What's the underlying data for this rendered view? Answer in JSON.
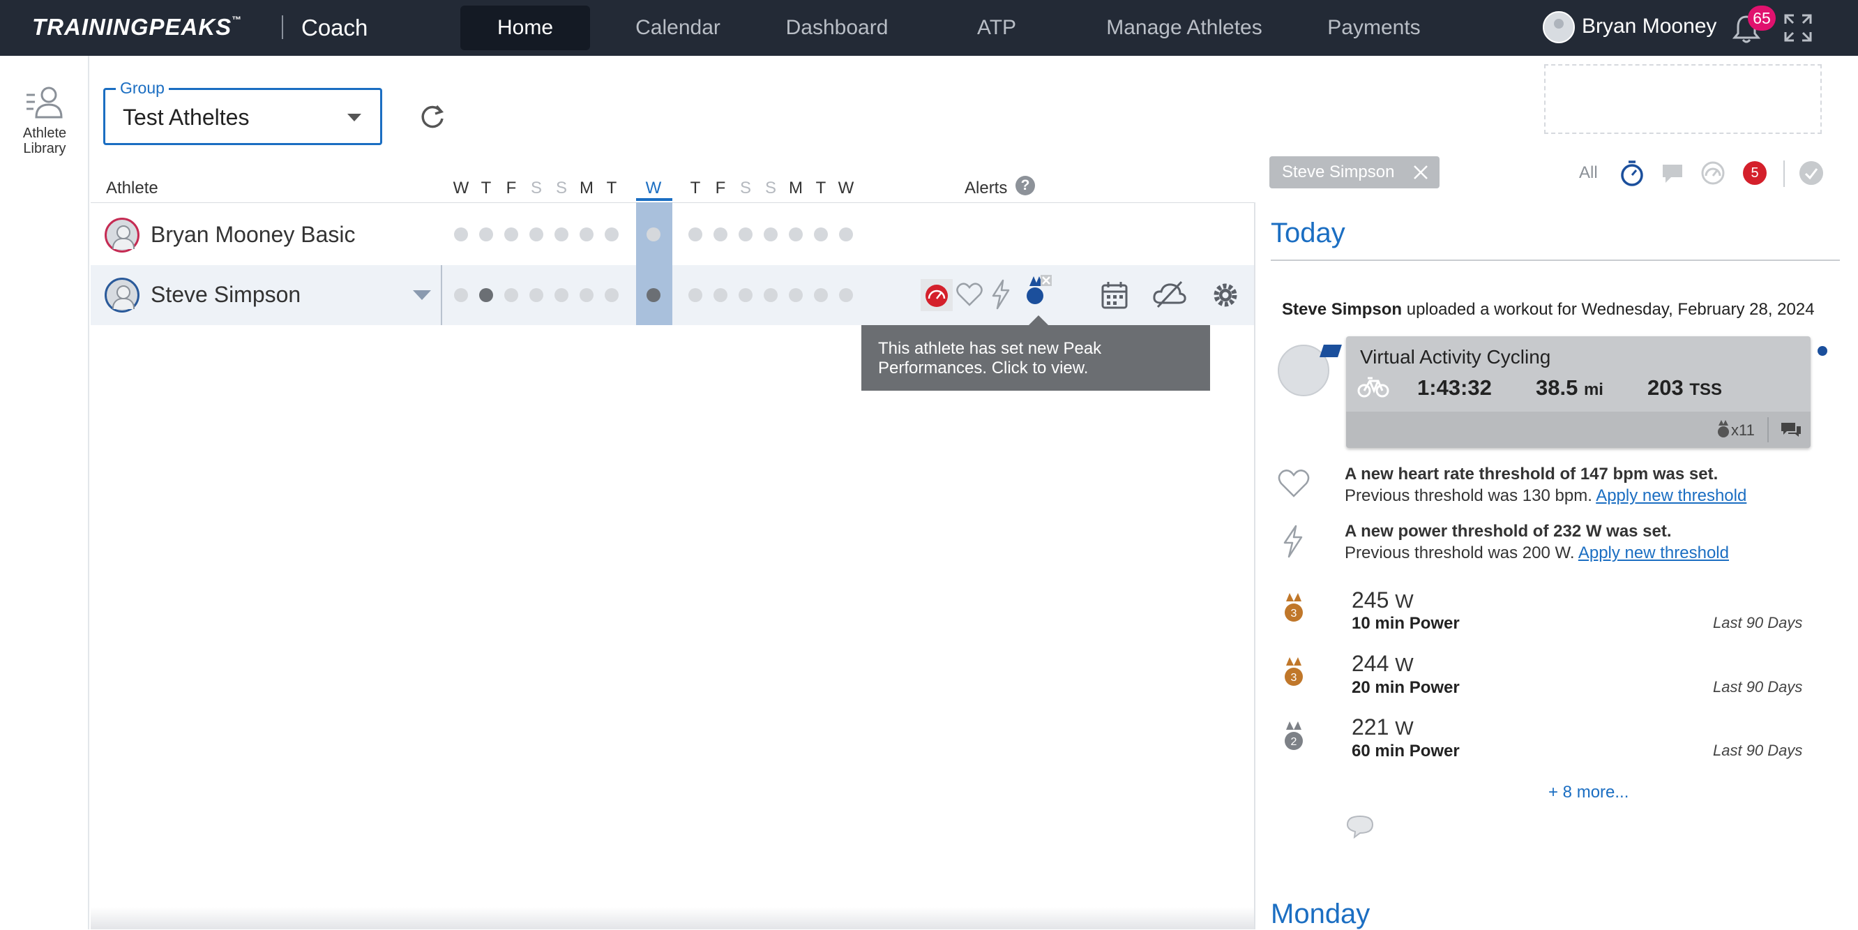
{
  "topnav": {
    "brand": "TRAININGPEAKS",
    "brand_mark": "™",
    "product": "Coach",
    "items": [
      {
        "label": "Home",
        "active": true
      },
      {
        "label": "Calendar",
        "active": false
      },
      {
        "label": "Dashboard",
        "active": false
      },
      {
        "label": "ATP",
        "active": false
      },
      {
        "label": "Manage Athletes",
        "active": false
      },
      {
        "label": "Payments",
        "active": false
      }
    ],
    "user_name": "Bryan Mooney",
    "notification_count": "65"
  },
  "rail": {
    "athlete_library": "Athlete Library"
  },
  "group": {
    "legend": "Group",
    "value": "Test Atheltes"
  },
  "table": {
    "athlete_header": "Athlete",
    "alerts_header": "Alerts",
    "help": "?",
    "days": [
      "W",
      "T",
      "F",
      "S",
      "S",
      "M",
      "T",
      "W",
      "T",
      "F",
      "S",
      "S",
      "M",
      "T",
      "W"
    ],
    "rows": [
      {
        "name": "Bryan Mooney Basic"
      },
      {
        "name": "Steve Simpson"
      }
    ]
  },
  "tooltip": {
    "text": "This athlete has set new Peak Performances. Click to view."
  },
  "feed": {
    "filter_chip": "Steve Simpson",
    "filter_all": "All",
    "filter_count": "5",
    "today_heading": "Today",
    "upload_athlete": "Steve Simpson",
    "upload_text": " uploaded a workout for Wednesday, February 28, 2024",
    "workout": {
      "title": "Virtual Activity Cycling",
      "duration": "1:43:32",
      "distance": "38.5",
      "distance_unit": "mi",
      "tss": "203",
      "tss_unit": "TSS",
      "medal_count": "x11"
    },
    "thresholds": [
      {
        "title": "A new heart rate threshold of 147 bpm was set.",
        "sub": "Previous threshold was 130 bpm. ",
        "link": "Apply new threshold"
      },
      {
        "title": "A new power threshold of 232 W was set.",
        "sub": "Previous threshold was 200 W. ",
        "link": "Apply new threshold"
      }
    ],
    "peaks": [
      {
        "value": "245",
        "unit": "W",
        "label": "10 min Power",
        "range": "Last 90 Days",
        "rank": "3"
      },
      {
        "value": "244",
        "unit": "W",
        "label": "20 min Power",
        "range": "Last 90 Days",
        "rank": "3"
      },
      {
        "value": "221",
        "unit": "W",
        "label": "60 min Power",
        "range": "Last 90 Days",
        "rank": "2"
      }
    ],
    "more": "+ 8 more...",
    "next_heading": "Monday"
  },
  "colors": {
    "nav_bg": "#232a36",
    "accent_blue": "#1b6ec2",
    "alert_red": "#d4202b",
    "badge_pink": "#e0126e",
    "bronze": "#c0772a"
  }
}
